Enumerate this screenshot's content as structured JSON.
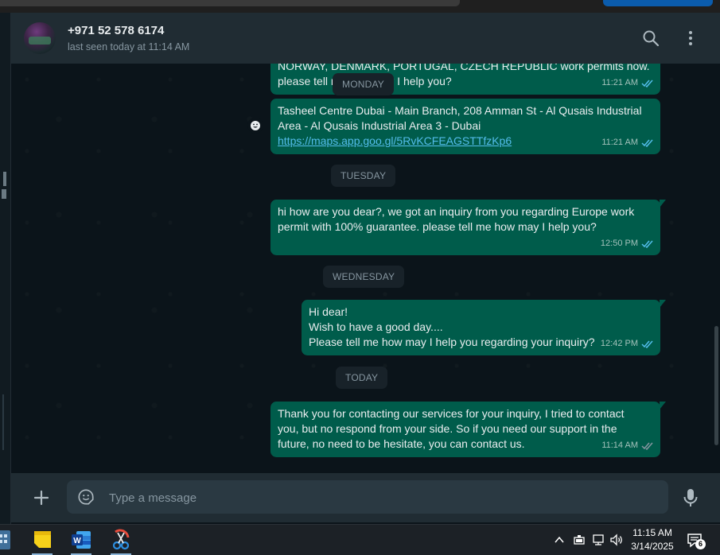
{
  "header": {
    "contact_name": "+971 52 578 6174",
    "status": "last seen today at 11:14 AM"
  },
  "messages": [
    {
      "lines": [
        "NORWAY, DENMARK, PORTUGAL,  CZECH REPUBLIC work permits now.",
        "please tell me how may I help you?"
      ],
      "time": "11:21 AM"
    },
    {
      "lines": [
        "Tasheel Centre Dubai - Main Branch, 208 Amman St - Al Qusais Industrial",
        "Area - Al Qusais Industrial Area 3 - Dubai"
      ],
      "link": "https://maps.app.goo.gl/5RvKCFEAGSTTfzKp6",
      "time": "11:21 AM"
    },
    {
      "lines": [
        "hi how are you dear?, we got an inquiry from you regarding Europe work",
        "permit with 100% guarantee. please tell me how may I help you?"
      ],
      "time": "12:50 PM"
    },
    {
      "lines": [
        "Hi dear!",
        "Wish to have a good day....",
        "Please tell me how may I help you regarding your inquiry?"
      ],
      "time": "12:42 PM"
    },
    {
      "lines": [
        "Thank you for contacting our services for your inquiry, I tried to contact",
        "you, but no respond from your side. So if you need our support in the",
        "future, no need to be hesitate, you can contact us."
      ],
      "time": "11:14 AM"
    }
  ],
  "day_separators": [
    "MONDAY",
    "TUESDAY",
    "WEDNESDAY",
    "TODAY"
  ],
  "composer": {
    "placeholder": "Type a message"
  },
  "taskbar": {
    "time": "11:15 AM",
    "date": "3/14/2025",
    "notification_count": "6",
    "apps": [
      "calculator-icon",
      "sticky-notes-icon",
      "word-icon",
      "snipping-tool-icon"
    ]
  },
  "colors": {
    "outgoing_bubble": "#005c4b",
    "header_bg": "#202c33",
    "chat_bg": "#0b141a",
    "tick_read": "#53bdeb"
  },
  "icons": [
    "search-icon",
    "menu-kebab-icon",
    "plus-icon",
    "sticker-icon",
    "microphone-icon",
    "double-tick-icon",
    "emoji-reaction-icon"
  ]
}
